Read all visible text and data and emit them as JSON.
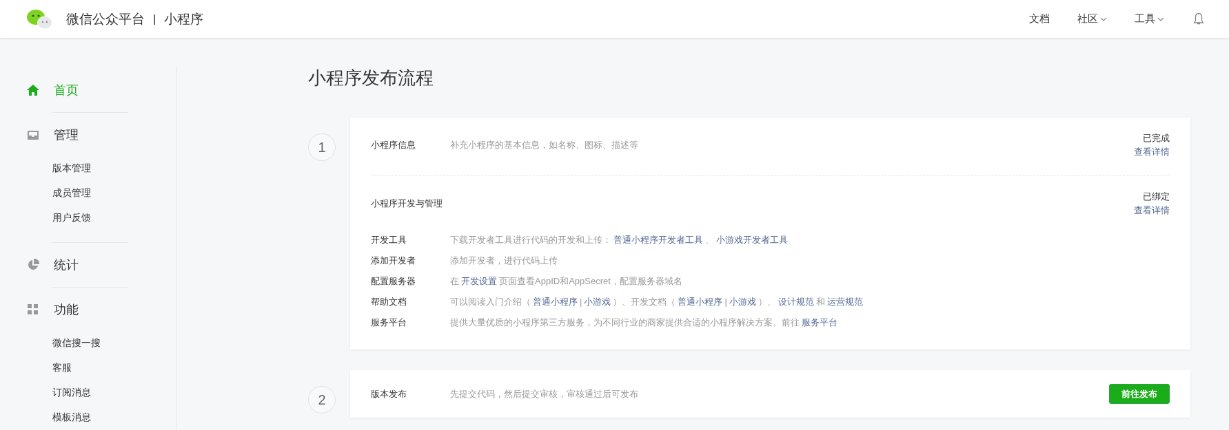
{
  "header": {
    "brand": "微信公众平台",
    "separator": "|",
    "product": "小程序",
    "nav": [
      {
        "label": "文档",
        "dropdown": false
      },
      {
        "label": "社区",
        "dropdown": true
      },
      {
        "label": "工具",
        "dropdown": true
      }
    ]
  },
  "sidebar": {
    "groups": [
      {
        "label": "首页",
        "selected": true
      },
      {
        "label": "管理",
        "selected": false,
        "children": [
          {
            "label": "版本管理"
          },
          {
            "label": "成员管理"
          },
          {
            "label": "用户反馈"
          }
        ]
      },
      {
        "label": "统计",
        "selected": false
      },
      {
        "label": "功能",
        "selected": false,
        "children": [
          {
            "label": "微信搜一搜"
          },
          {
            "label": "客服"
          },
          {
            "label": "订阅消息"
          },
          {
            "label": "模板消息"
          }
        ]
      }
    ]
  },
  "page_title": "小程序发布流程",
  "steps": [
    {
      "number": "1",
      "sections": [
        {
          "title": "小程序信息",
          "description": "补充小程序的基本信息，如名称、图标、描述等",
          "status": "已完成",
          "status_link": "查看详情"
        },
        {
          "title": "小程序开发与管理",
          "status": "已绑定",
          "status_link": "查看详情",
          "rows": [
            {
              "label": "开发工具",
              "segments": [
                {
                  "text": "下载开发者工具进行代码的开发和上传：",
                  "link": false
                },
                {
                  "text": "普通小程序开发者工具",
                  "link": true
                },
                {
                  "text": "、",
                  "link": false
                },
                {
                  "text": "小游戏开发者工具",
                  "link": true
                }
              ]
            },
            {
              "label": "添加开发者",
              "segments": [
                {
                  "text": "添加开发者，进行代码上传",
                  "link": false
                }
              ]
            },
            {
              "label": "配置服务器",
              "segments": [
                {
                  "text": "在",
                  "link": false
                },
                {
                  "text": "开发设置",
                  "link": true
                },
                {
                  "text": "页面查看AppID和AppSecret，配置服务器域名",
                  "link": false
                }
              ]
            },
            {
              "label": "帮助文档",
              "segments": [
                {
                  "text": "可以阅读入门介绍（",
                  "link": false
                },
                {
                  "text": "普通小程序",
                  "link": true
                },
                {
                  "text": "|",
                  "link": false
                },
                {
                  "text": "小游戏",
                  "link": true
                },
                {
                  "text": "）、开发文档（",
                  "link": false
                },
                {
                  "text": "普通小程序",
                  "link": true
                },
                {
                  "text": "|",
                  "link": false
                },
                {
                  "text": "小游戏",
                  "link": true
                },
                {
                  "text": "）、",
                  "link": false
                },
                {
                  "text": "设计规范",
                  "link": true
                },
                {
                  "text": "和",
                  "link": false
                },
                {
                  "text": "运营规范",
                  "link": true
                }
              ]
            },
            {
              "label": "服务平台",
              "segments": [
                {
                  "text": "提供大量优质的小程序第三方服务，为不同行业的商家提供合适的小程序解决方案。前往",
                  "link": false
                },
                {
                  "text": "服务平台",
                  "link": true
                }
              ]
            }
          ]
        }
      ]
    },
    {
      "number": "2",
      "sections": [
        {
          "title": "版本发布",
          "description": "先提交代码，然后提交审核，审核通过后可发布",
          "button": "前往发布"
        }
      ]
    }
  ]
}
